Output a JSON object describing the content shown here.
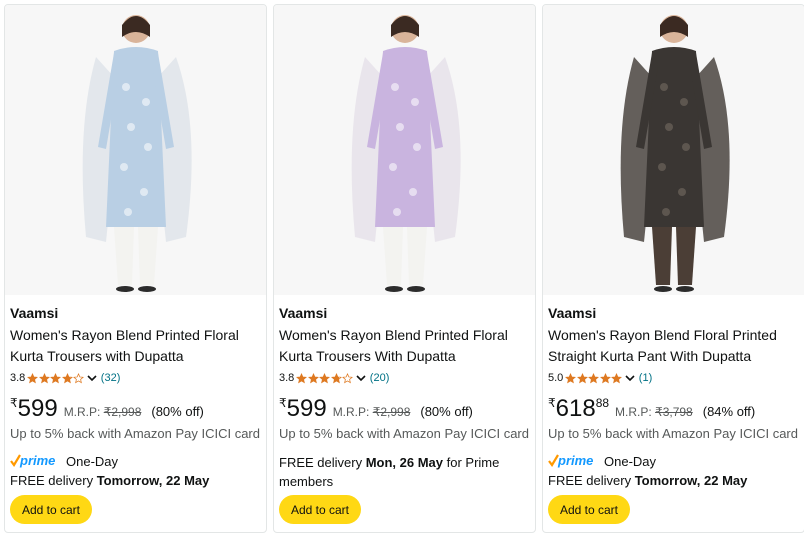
{
  "products": [
    {
      "brand": "Vaamsi",
      "title": "Women's Rayon Blend Printed Floral Kurta Trousers with Dupatta",
      "rating": "3.8",
      "stars": 3.8,
      "reviews": "(32)",
      "currency": "₹",
      "price_whole": "599",
      "price_fraction": "",
      "mrp_label": "M.R.P:",
      "mrp_value": "₹2,998",
      "discount": "(80% off)",
      "cashback": "Up to 5% back with Amazon Pay ICICI card",
      "prime": true,
      "prime_text": "One-Day",
      "delivery_prefix": "FREE delivery ",
      "delivery_date": "Tomorrow, 22 May",
      "delivery_suffix": "",
      "add_to_cart": "Add to cart",
      "image": {
        "name": "kurta-blue",
        "dress": "#b9cfe4",
        "dupatta": "#dfe4ea",
        "trouser": "#f3f3f0"
      }
    },
    {
      "brand": "Vaamsi",
      "title": "Women's Rayon Blend Printed Floral Kurta Trousers With Dupatta",
      "rating": "3.8",
      "stars": 3.8,
      "reviews": "(20)",
      "currency": "₹",
      "price_whole": "599",
      "price_fraction": "",
      "mrp_label": "M.R.P:",
      "mrp_value": "₹2,998",
      "discount": "(80% off)",
      "cashback": "Up to 5% back with Amazon Pay ICICI card",
      "prime": false,
      "prime_text": "",
      "delivery_prefix": "FREE delivery ",
      "delivery_date": "Mon, 26 May",
      "delivery_suffix": " for Prime members",
      "add_to_cart": "Add to cart",
      "image": {
        "name": "kurta-lilac",
        "dress": "#c9b4df",
        "dupatta": "#e6e2ea",
        "trouser": "#f3f3f0"
      }
    },
    {
      "brand": "Vaamsi",
      "title": "Women's Rayon Blend Floral Printed Straight Kurta Pant With Dupatta",
      "rating": "5.0",
      "stars": 5,
      "reviews": "(1)",
      "currency": "₹",
      "price_whole": "618",
      "price_fraction": "88",
      "mrp_label": "M.R.P:",
      "mrp_value": "₹3,798",
      "discount": "(84% off)",
      "cashback": "Up to 5% back with Amazon Pay ICICI card",
      "prime": true,
      "prime_text": "One-Day",
      "delivery_prefix": "FREE delivery ",
      "delivery_date": "Tomorrow, 22 May",
      "delivery_suffix": "",
      "add_to_cart": "Add to cart",
      "image": {
        "name": "kurta-black",
        "dress": "#3a3633",
        "dupatta": "#4a4440",
        "trouser": "#4b3e36"
      }
    }
  ],
  "colors": {
    "star": "#de7921",
    "link": "#007185",
    "prime_check": "#ff9900",
    "prime_word": "#1399ff",
    "button": "#ffd814"
  },
  "icons": [
    "star-icon",
    "chevron-down-icon",
    "prime-logo-icon"
  ]
}
